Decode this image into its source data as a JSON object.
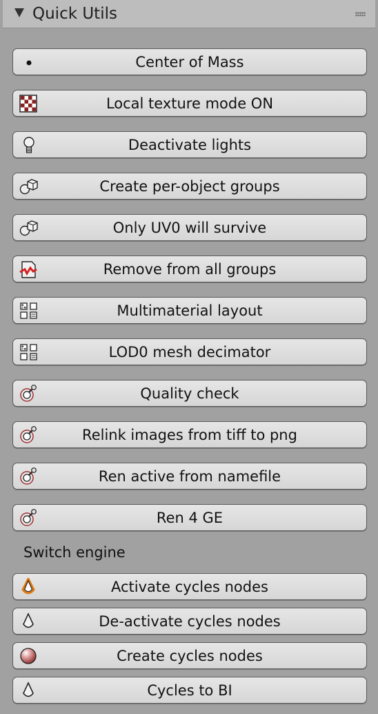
{
  "panel": {
    "title": "Quick Utils"
  },
  "buttons": [
    {
      "label": "Center of Mass",
      "icon": "dot-icon"
    },
    {
      "label": "Local texture mode ON",
      "icon": "texture-checker-icon"
    },
    {
      "label": "Deactivate lights",
      "icon": "light-bulb-icon"
    },
    {
      "label": "Create per-object groups",
      "icon": "group-objects-icon"
    },
    {
      "label": "Only UV0 will survive",
      "icon": "group-objects-icon"
    },
    {
      "label": "Remove from all groups",
      "icon": "remove-groups-icon"
    },
    {
      "label": "Multimaterial layout",
      "icon": "material-layout-icon"
    },
    {
      "label": "LOD0 mesh decimator",
      "icon": "material-layout-icon"
    },
    {
      "label": "Quality check",
      "icon": "script-node-icon"
    },
    {
      "label": "Relink images from tiff to png",
      "icon": "script-node-icon"
    },
    {
      "label": "Ren active from namefile",
      "icon": "script-node-icon"
    },
    {
      "label": "Ren 4 GE",
      "icon": "script-node-icon"
    }
  ],
  "section": {
    "label": "Switch engine"
  },
  "engine_buttons": [
    {
      "label": "Activate cycles nodes",
      "icon": "cycles-active-icon"
    },
    {
      "label": "De-activate cycles nodes",
      "icon": "cycles-icon"
    },
    {
      "label": "Create cycles nodes",
      "icon": "material-sphere-icon"
    },
    {
      "label": "Cycles to BI",
      "icon": "cycles-icon"
    }
  ]
}
